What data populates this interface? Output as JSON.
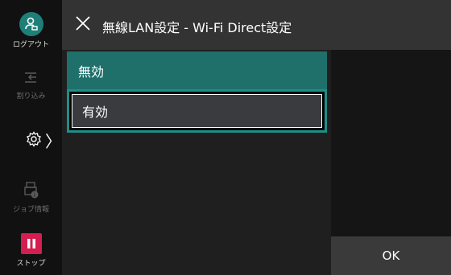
{
  "sidebar": {
    "logout_label": "ログアウト",
    "interrupt_label": "割り込み",
    "job_info_label": "ジョブ情報",
    "stop_label": "ストップ",
    "settings_chevron": "〉"
  },
  "header": {
    "title": "無線LAN設定 - Wi-Fi Direct設定"
  },
  "options": [
    {
      "label": "無効"
    },
    {
      "label": "有効"
    }
  ],
  "footer": {
    "ok_label": "OK"
  },
  "colors": {
    "accent": "#1f706b",
    "stop": "#d51d4f",
    "header": "#333333"
  },
  "icons": [
    "user-icon",
    "interrupt-icon",
    "gear-icon",
    "chevron-right-icon",
    "job-info-icon",
    "pause-icon",
    "close-icon"
  ]
}
